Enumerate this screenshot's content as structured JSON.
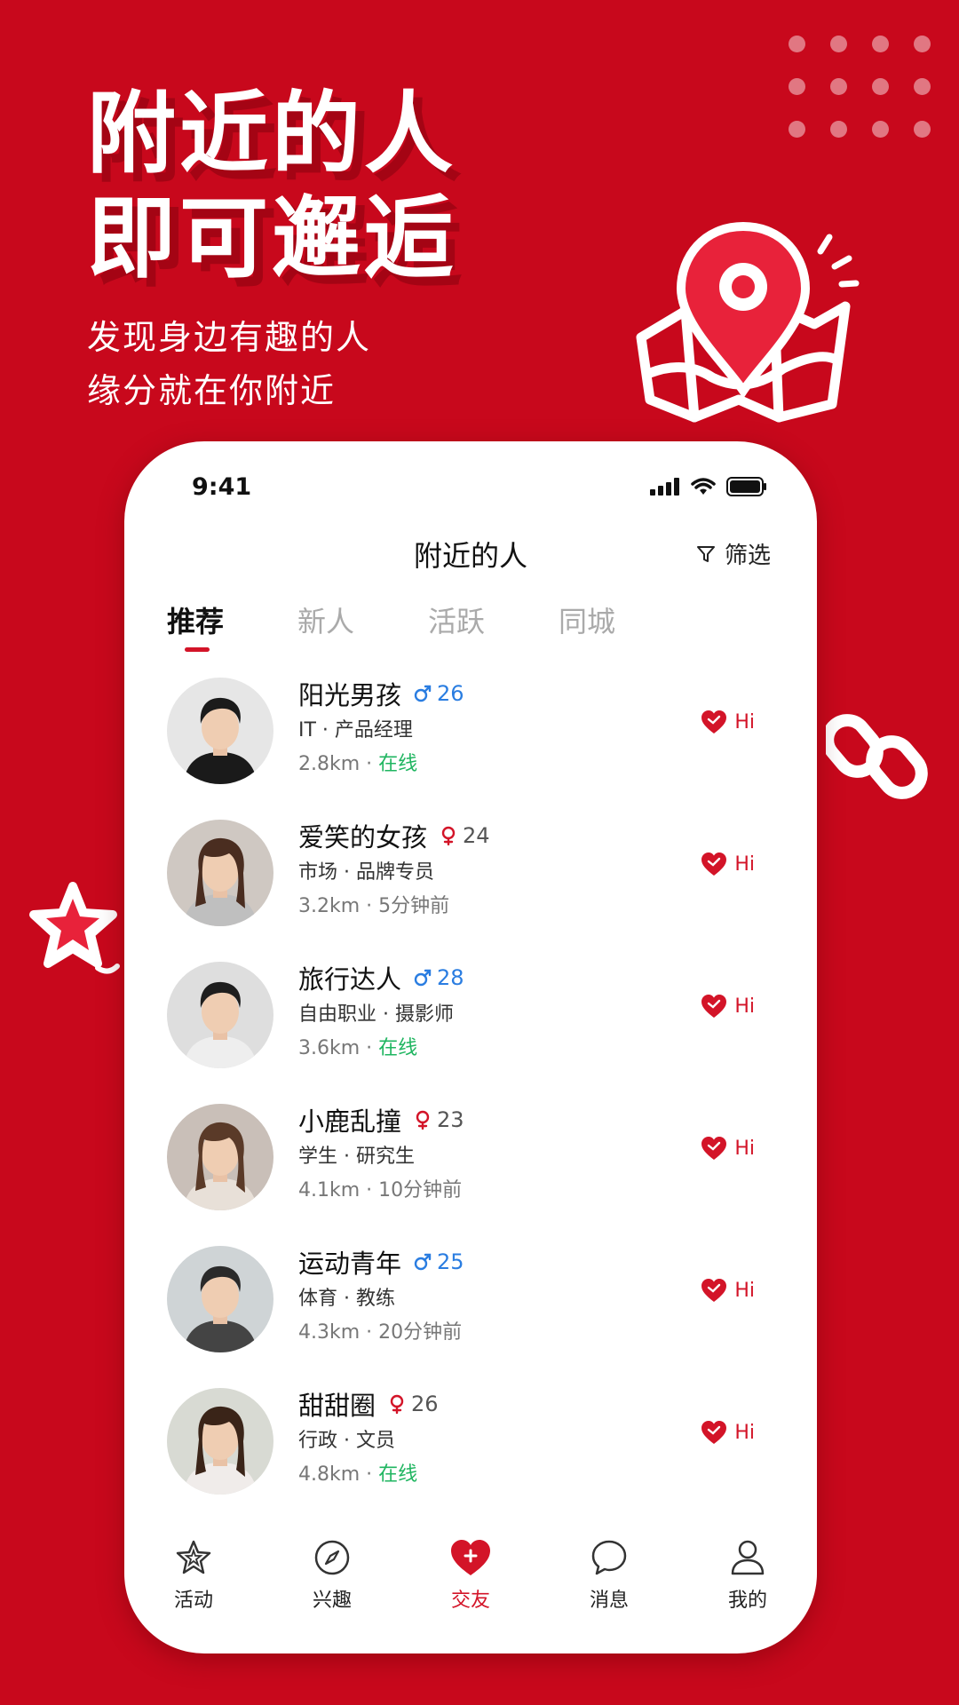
{
  "promo": {
    "headline_line1": "附近的人",
    "headline_line2": "即可邂逅",
    "sub_line1": "发现身边有趣的人",
    "sub_line2": "缘分就在你附近"
  },
  "colors": {
    "brand_red": "#c8081c",
    "accent_red": "#d31428",
    "male_blue": "#2a7de1",
    "female_red": "#d31428",
    "online_green": "#1fb560"
  },
  "status_bar": {
    "time": "9:41"
  },
  "nav": {
    "title": "附近的人",
    "filter_label": "筛选",
    "filter_icon": "filter-icon"
  },
  "tabs": [
    {
      "label": "推荐",
      "active": true
    },
    {
      "label": "新人",
      "active": false
    },
    {
      "label": "活跃",
      "active": false
    },
    {
      "label": "同城",
      "active": false
    }
  ],
  "users": [
    {
      "name": "阳光男孩",
      "gender": "male",
      "age": "26",
      "meta": "IT · 产品经理",
      "distance": "2.8km",
      "activity": "在线",
      "online": true,
      "hi": "Hi"
    },
    {
      "name": "爱笑的女孩",
      "gender": "female",
      "age": "24",
      "meta": "市场 · 品牌专员",
      "distance": "3.2km",
      "activity": "5分钟前",
      "online": false,
      "hi": "Hi"
    },
    {
      "name": "旅行达人",
      "gender": "male",
      "age": "28",
      "meta": "自由职业 · 摄影师",
      "distance": "3.6km",
      "activity": "在线",
      "online": true,
      "hi": "Hi"
    },
    {
      "name": "小鹿乱撞",
      "gender": "female",
      "age": "23",
      "meta": "学生 · 研究生",
      "distance": "4.1km",
      "activity": "10分钟前",
      "online": false,
      "hi": "Hi"
    },
    {
      "name": "运动青年",
      "gender": "male",
      "age": "25",
      "meta": "体育 · 教练",
      "distance": "4.3km",
      "activity": "20分钟前",
      "online": false,
      "hi": "Hi"
    },
    {
      "name": "甜甜圈",
      "gender": "female",
      "age": "26",
      "meta": "行政 · 文员",
      "distance": "4.8km",
      "activity": "在线",
      "online": true,
      "hi": "Hi"
    }
  ],
  "tabbar": [
    {
      "label": "活动",
      "icon": "star-icon",
      "active": false
    },
    {
      "label": "兴趣",
      "icon": "compass-icon",
      "active": false
    },
    {
      "label": "交友",
      "icon": "heart-plus-icon",
      "active": true
    },
    {
      "label": "消息",
      "icon": "chat-bubble-icon",
      "active": false
    },
    {
      "label": "我的",
      "icon": "person-icon",
      "active": false
    }
  ]
}
